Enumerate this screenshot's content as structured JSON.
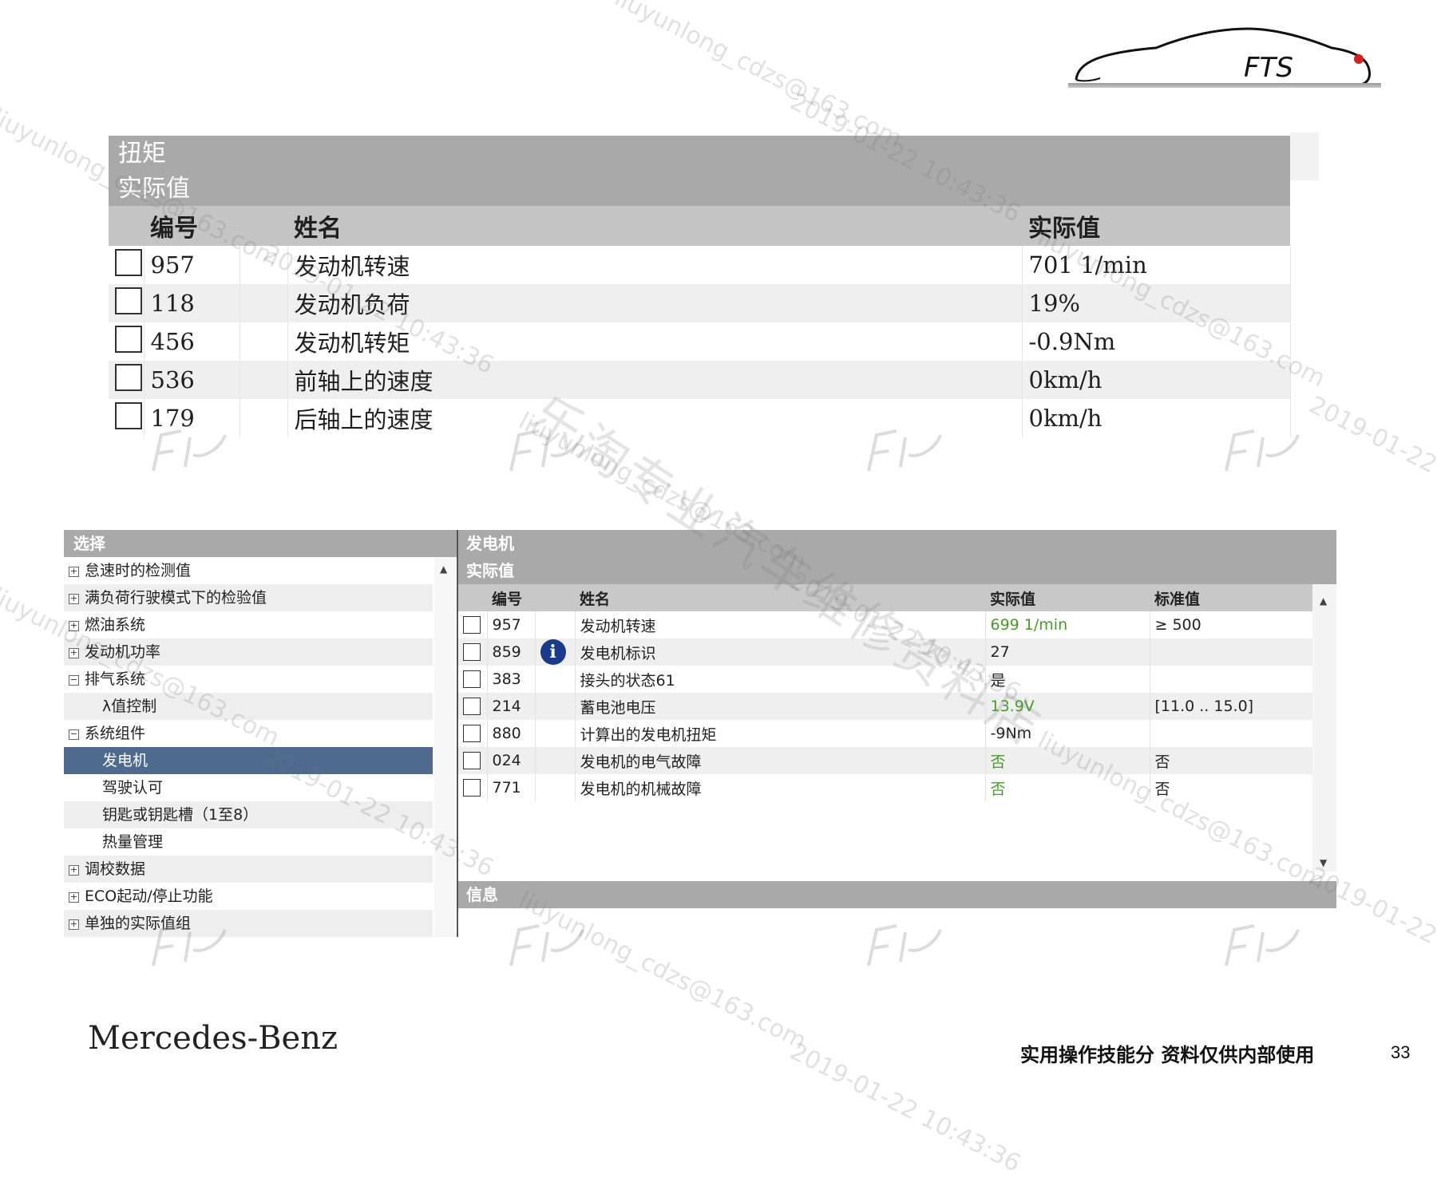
{
  "logo": {
    "text": "FTS"
  },
  "torque_panel": {
    "title": "扭矩",
    "subtitle": "实际值",
    "columns": [
      "编号",
      "姓名",
      "实际值"
    ],
    "rows": [
      {
        "id": "957",
        "name": "发动机转速",
        "value": "701 1/min"
      },
      {
        "id": "118",
        "name": "发动机负荷",
        "value": "19%"
      },
      {
        "id": "456",
        "name": "发动机转矩",
        "value": "-0.9Nm"
      },
      {
        "id": "536",
        "name": "前轴上的速度",
        "value": "0km/h"
      },
      {
        "id": "179",
        "name": "后轴上的速度",
        "value": "0km/h"
      }
    ]
  },
  "selection_panel": {
    "title": "选择",
    "items": [
      {
        "label": "怠速时的检测值",
        "toggle": "+",
        "level": 1
      },
      {
        "label": "满负荷行驶模式下的检验值",
        "toggle": "+",
        "level": 1
      },
      {
        "label": "燃油系统",
        "toggle": "+",
        "level": 1
      },
      {
        "label": "发动机功率",
        "toggle": "+",
        "level": 1
      },
      {
        "label": "排气系统",
        "toggle": "−",
        "level": 1
      },
      {
        "label": "λ值控制",
        "toggle": "",
        "level": 3
      },
      {
        "label": "系统组件",
        "toggle": "−",
        "level": 1
      },
      {
        "label": "发电机",
        "toggle": "",
        "level": 2,
        "selected": true
      },
      {
        "label": "驾驶认可",
        "toggle": "",
        "level": 2
      },
      {
        "label": "钥匙或钥匙槽（1至8）",
        "toggle": "",
        "level": 2
      },
      {
        "label": "热量管理",
        "toggle": "",
        "level": 2
      },
      {
        "label": "调校数据",
        "toggle": "+",
        "level": 1
      },
      {
        "label": "ECO起动/停止功能",
        "toggle": "+",
        "level": 1
      },
      {
        "label": "单独的实际值组",
        "toggle": "+",
        "level": 1
      }
    ]
  },
  "generator_panel": {
    "title": "发电机",
    "subtitle": "实际值",
    "columns": [
      "编号",
      "姓名",
      "实际值",
      "标准值"
    ],
    "rows": [
      {
        "id": "957",
        "name": "发动机转速",
        "value": "699 1/min",
        "std": "≥ 500",
        "green": true,
        "info": false
      },
      {
        "id": "859",
        "name": "发电机标识",
        "value": "27",
        "std": "",
        "green": false,
        "info": true
      },
      {
        "id": "383",
        "name": "接头的状态61",
        "value": "是",
        "std": "",
        "green": false,
        "info": false
      },
      {
        "id": "214",
        "name": "蓄电池电压",
        "value": "13.9V",
        "std": "[11.0 .. 15.0]",
        "green": true,
        "info": false
      },
      {
        "id": "880",
        "name": "计算出的发电机扭矩",
        "value": "-9Nm",
        "std": "",
        "green": false,
        "info": false
      },
      {
        "id": "024",
        "name": "发电机的电气故障",
        "value": "否",
        "std": "否",
        "green": true,
        "info": false
      },
      {
        "id": "771",
        "name": "发电机的机械故障",
        "value": "否",
        "std": "否",
        "green": true,
        "info": false
      }
    ],
    "info_label": "信息"
  },
  "footer": {
    "brand": "Mercedes-Benz",
    "note": "实用操作技能分 资料仅供内部使用",
    "page": "33"
  },
  "watermarks": {
    "email": "liuyunlong_cdzs@163.com",
    "timestamp": "2019-01-22 10:43:36",
    "shop": "乐淘专业汽车维修资料店"
  },
  "colors": {
    "header_gray": "#a9a9a9",
    "selected_blue": "#4f6a8f",
    "value_green": "#4a9a2a",
    "info_blue": "#1a3a8c"
  }
}
